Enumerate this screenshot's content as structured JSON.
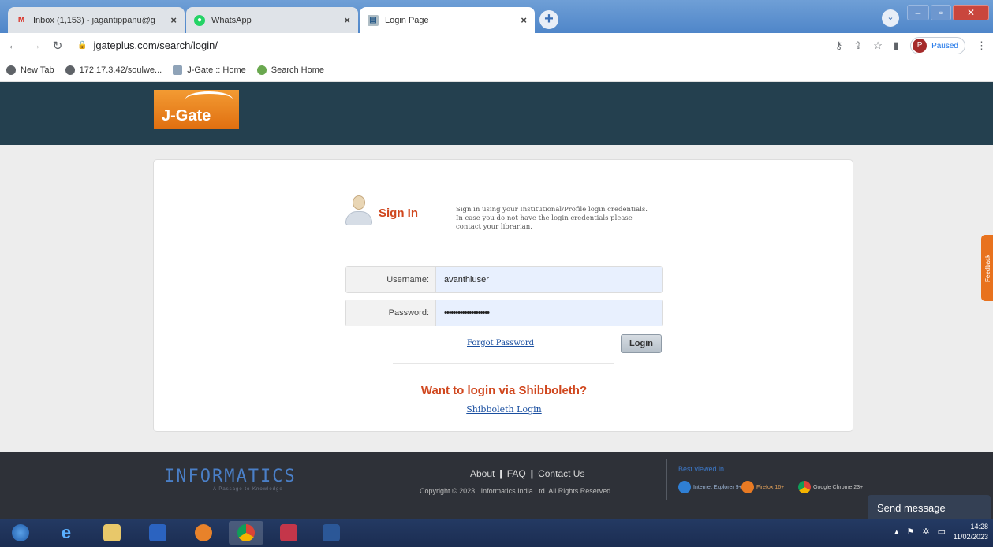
{
  "browser": {
    "tabs": [
      {
        "title": "Inbox (1,153) - jagantippanu@g",
        "icon": "gmail-icon",
        "close": "×"
      },
      {
        "title": "WhatsApp",
        "icon": "whatsapp-icon",
        "close": "×"
      },
      {
        "title": "Login Page",
        "icon": "jgate-favicon",
        "close": "×"
      }
    ],
    "new_tab": "+",
    "address": "jgateplus.com/search/login/",
    "profile": {
      "initial": "P",
      "status": "Paused"
    },
    "bookmarks": [
      {
        "label": "New Tab",
        "icon": "globe-icon"
      },
      {
        "label": "172.17.3.42/soulwe...",
        "icon": "globe-icon"
      },
      {
        "label": "J-Gate :: Home",
        "icon": "jgate-favicon"
      },
      {
        "label": "Search Home",
        "icon": "search-leaf-icon"
      }
    ]
  },
  "header": {
    "logo_text": "J-Gate"
  },
  "signin": {
    "title": "Sign In",
    "description": "Sign in using your Institutional/Profile login credentials. In case you do not have the login credentials please contact your librarian.",
    "username_label": "Username:",
    "username_value": "avanthiuser",
    "password_label": "Password:",
    "password_value": "••••••••••••••••••••",
    "forgot_label": "Forgot Password",
    "login_label": "Login"
  },
  "shibboleth": {
    "title": "Want to login via Shibboleth?",
    "link": "Shibboleth Login"
  },
  "feedback_label": "Feedback",
  "footer": {
    "brand": "INFORMATICS",
    "brand_sub": "A Passage to Knowledge",
    "links": [
      "About",
      "FAQ",
      "Contact Us"
    ],
    "copyright": "Copyright © 2023 . Informatics India Ltd. All Rights Reserved.",
    "best_viewed": "Best viewed in",
    "browsers": [
      "Internet Explorer 9+",
      "Firefox 16+",
      "Google Chrome 23+"
    ]
  },
  "chat": {
    "label": "Send message"
  },
  "taskbar": {
    "time": "14:28",
    "date": "11/02/2023"
  },
  "colors": {
    "header_bg": "#24404f",
    "accent": "#d0471e",
    "link": "#1a4fa0",
    "logo": "#e8831e"
  }
}
